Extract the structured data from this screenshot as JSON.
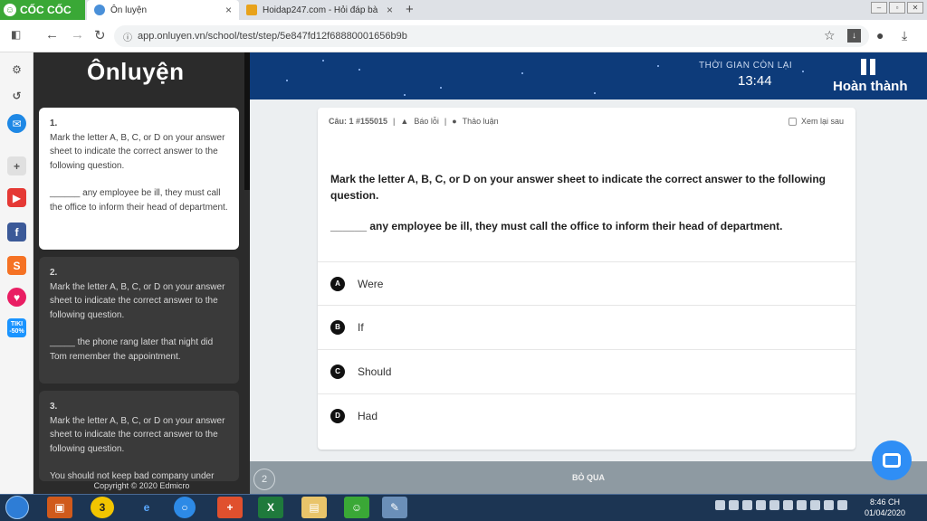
{
  "browser": {
    "brand": "CỐC CỐC",
    "tabs": [
      {
        "title": "Ôn luyện",
        "close": "×"
      },
      {
        "title": "Hoidap247.com - Hỏi đáp bà",
        "close": "×"
      }
    ],
    "new_tab": "+",
    "url": "app.onluyen.vn/school/test/step/5e847fd12f68880001656b9b"
  },
  "site": {
    "logo": "Ônluyện",
    "copyright": "Copyright © 2020 Edmicro"
  },
  "questions_list": [
    {
      "num": "1.",
      "instruction": "Mark the letter A, B, C, or D on your answer sheet to indicate the correct answer to the following question.",
      "stem": "______ any employee be ill, they must call the office to inform their head of department."
    },
    {
      "num": "2.",
      "instruction": "Mark the letter A, B, C, or D on your answer sheet to indicate the correct answer to the following question.",
      "stem": "_____ the phone rang later that night did Tom remember the appointment."
    },
    {
      "num": "3.",
      "instruction": "Mark the letter A, B, C, or D on your answer sheet to indicate the correct answer to the following question.",
      "stem": "You should not keep bad company under"
    }
  ],
  "header": {
    "timer_label": "THỜI GIAN CÒN LẠI",
    "timer": "13:44",
    "finish": "Hoàn thành"
  },
  "question": {
    "code": "Câu: 1 #155015",
    "report": "Báo lỗi",
    "discuss": "Thảo luận",
    "review_later": "Xem lại sau",
    "prompt": "Mark the letter A, B, C, or D on your answer sheet to indicate the correct answer to the following question.",
    "stem": "______ any employee be ill, they must call the office to inform their head of department.",
    "options": [
      {
        "letter": "A",
        "text": "Were"
      },
      {
        "letter": "B",
        "text": "If"
      },
      {
        "letter": "C",
        "text": "Should"
      },
      {
        "letter": "D",
        "text": "Had"
      }
    ]
  },
  "footer": {
    "page_number": "2",
    "skip": "BỎ QUA"
  },
  "sidebar_badge": "TIKI -50%",
  "taskbar": {
    "time": "8:46 CH",
    "date": "01/04/2020"
  }
}
